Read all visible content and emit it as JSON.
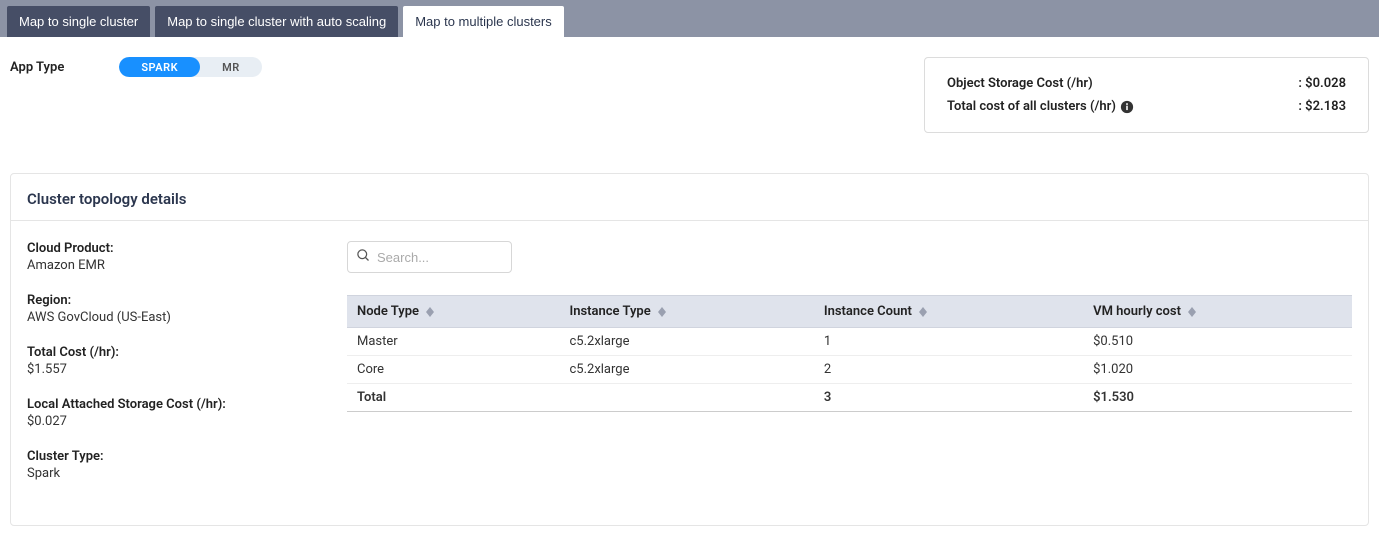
{
  "tabs": {
    "single": "Map to single cluster",
    "single_autoscale": "Map to single cluster with auto scaling",
    "multiple": "Map to multiple clusters"
  },
  "app_type": {
    "label": "App Type",
    "spark": "SPARK",
    "mr": "MR"
  },
  "cost_summary": {
    "object_storage_label": "Object Storage Cost (/hr)",
    "object_storage_value": ": $0.028",
    "total_clusters_label": "Total cost of all clusters (/hr)",
    "total_clusters_value": ": $2.183"
  },
  "panel": {
    "title": "Cluster topology details",
    "meta": {
      "cloud_product_label": "Cloud Product:",
      "cloud_product_value": "Amazon EMR",
      "region_label": "Region:",
      "region_value": "AWS GovCloud (US-East)",
      "total_cost_label": "Total Cost (/hr):",
      "total_cost_value": "$1.557",
      "local_storage_label": "Local Attached Storage Cost (/hr):",
      "local_storage_value": "$0.027",
      "cluster_type_label": "Cluster Type:",
      "cluster_type_value": "Spark"
    },
    "search_placeholder": "Search...",
    "columns": {
      "node_type": "Node Type",
      "instance_type": "Instance Type",
      "instance_count": "Instance Count",
      "vm_hourly": "VM hourly cost"
    },
    "rows": [
      {
        "node_type": "Master",
        "instance_type": "c5.2xlarge",
        "instance_count": "1",
        "vm_hourly": "$0.510"
      },
      {
        "node_type": "Core",
        "instance_type": "c5.2xlarge",
        "instance_count": "2",
        "vm_hourly": "$1.020"
      }
    ],
    "total_row": {
      "label": "Total",
      "instance_count": "3",
      "vm_hourly": "$1.530"
    }
  }
}
